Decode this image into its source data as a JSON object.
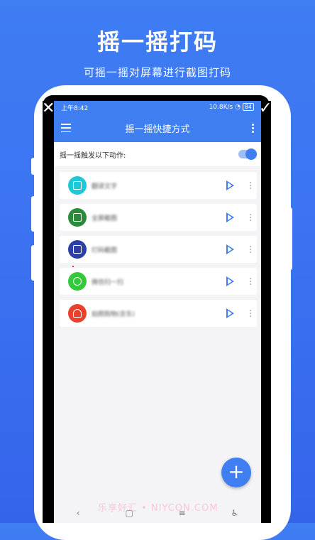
{
  "headline": "摇一摇打码",
  "subline": "可摇一摇对屏幕进行截图打码",
  "status": {
    "time": "上午8:42",
    "net": "10.8K/s",
    "battery": "84"
  },
  "app": {
    "title": "摇一摇快捷方式"
  },
  "toggle": {
    "label": "摇一摇触发以下动作:",
    "on": true
  },
  "items": [
    {
      "label": "翻译文字",
      "color": "#1fc8d6"
    },
    {
      "label": "全屏截图",
      "color": "#2b8b3a"
    },
    {
      "label": "打码截图",
      "color": "#2b3fa6"
    },
    {
      "label": "微信扫一扫",
      "color": "#34c93b"
    },
    {
      "label": "拍照购物(京东)",
      "color": "#e8412c"
    }
  ],
  "fab": {
    "symbol": "+"
  },
  "nav": {
    "back": "‹",
    "home": "▢",
    "menu": "≡",
    "access": "♿"
  },
  "watermark": "乐享好汇 • NIYCON.COM"
}
